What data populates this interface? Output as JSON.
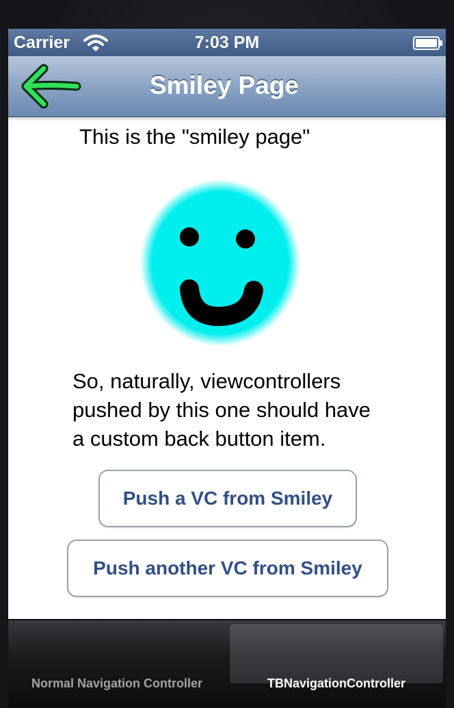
{
  "status_bar": {
    "carrier": "Carrier",
    "time": "7:03 PM",
    "wifi_icon": "wifi-icon",
    "battery_icon": "battery-icon"
  },
  "nav_bar": {
    "title": "Smiley Page",
    "back_icon": "green-arrow-left-icon"
  },
  "content": {
    "caption": "This is the \"smiley page\"",
    "smiley_icon": "smiley-face-icon",
    "description_lines": [
      "So, naturally, viewcontrollers",
      "pushed by this one should have",
      "a custom back button item."
    ],
    "buttons": {
      "push_vc": "Push a VC from Smiley",
      "push_another_vc": "Push another VC from Smiley"
    }
  },
  "tab_bar": {
    "tabs": [
      {
        "label": "Normal Navigation Controller",
        "selected": false
      },
      {
        "label": "TBNavigationController",
        "selected": true
      }
    ]
  },
  "colors": {
    "nav_bar": "#7d98bd",
    "button_text": "#324f85",
    "smiley_face": "#00eeee",
    "back_arrow": "#2fe05a"
  }
}
